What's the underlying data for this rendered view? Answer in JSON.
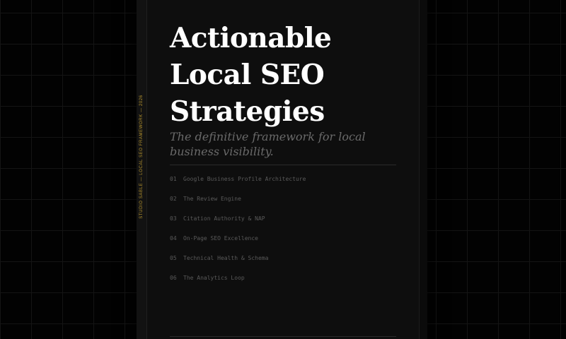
{
  "cover": {
    "spine_text": "STUDIO SABLE — LOCAL SEO FRAMEWORK — 2026",
    "title_lines": [
      "Actionable",
      "Local SEO",
      "Strategies"
    ],
    "subtitle_lines": [
      "The definitive framework for local",
      "business visibility."
    ]
  },
  "toc": [
    {
      "num": "01",
      "label": "Google Business Profile Architecture"
    },
    {
      "num": "02",
      "label": "The Review Engine"
    },
    {
      "num": "03",
      "label": "Citation Authority & NAP"
    },
    {
      "num": "04",
      "label": "On-Page SEO Excellence"
    },
    {
      "num": "05",
      "label": "Technical Health & Schema"
    },
    {
      "num": "06",
      "label": "The Analytics Loop"
    }
  ],
  "colors": {
    "background": "#000000",
    "cover": "#0e0e0e",
    "title": "#ffffff",
    "subtitle": "#6a6a6a",
    "toc": "#5a5a5a",
    "spine_accent": "#b7952e"
  }
}
